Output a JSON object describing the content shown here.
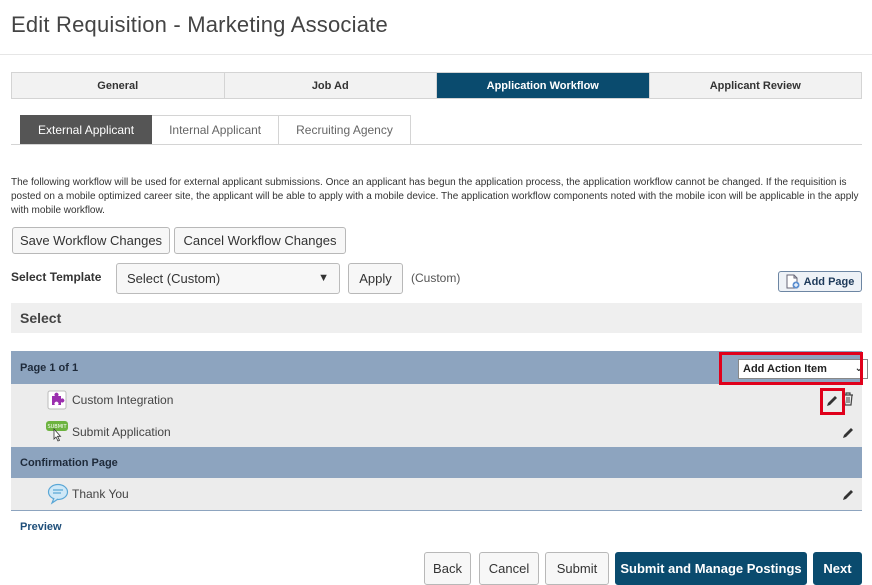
{
  "page": {
    "title": "Edit Requisition - Marketing Associate"
  },
  "main_tabs": [
    {
      "label": "General",
      "active": false
    },
    {
      "label": "Job Ad",
      "active": false
    },
    {
      "label": "Application Workflow",
      "active": true
    },
    {
      "label": "Applicant Review",
      "active": false
    }
  ],
  "sub_tabs": [
    {
      "label": "External Applicant",
      "active": true
    },
    {
      "label": "Internal Applicant",
      "active": false
    },
    {
      "label": "Recruiting Agency",
      "active": false
    }
  ],
  "description": "The following workflow will be used for external applicant submissions. Once an applicant has begun the application process, the application workflow cannot be changed. If the requisition is posted on a mobile optimized career site, the applicant will be able to apply with a mobile device. The application workflow components noted with the mobile icon will be applicable in the apply with mobile workflow.",
  "workflow_buttons": {
    "save": "Save Workflow Changes",
    "cancel": "Cancel Workflow Changes"
  },
  "template": {
    "label": "Select Template",
    "selected": "Select (Custom)",
    "apply": "Apply",
    "note": "(Custom)",
    "add_page": "Add Page"
  },
  "select_header": "Select",
  "workflow": {
    "page_header": "Page 1 of 1",
    "action_select": "Add Action Item",
    "items": [
      {
        "label": "Custom Integration",
        "icon": "puzzle-icon"
      },
      {
        "label": "Submit Application",
        "icon": "submit-icon"
      }
    ],
    "confirmation_header": "Confirmation Page",
    "confirmation_items": [
      {
        "label": "Thank You",
        "icon": "speech-bubble-icon"
      }
    ]
  },
  "preview_link": "Preview",
  "footer_buttons": {
    "back": "Back",
    "cancel": "Cancel",
    "submit": "Submit",
    "submit_manage": "Submit and Manage Postings",
    "next": "Next"
  },
  "colors": {
    "primary": "#0a4b6e",
    "section_header": "#8da4bf",
    "highlight": "#e0001b",
    "puzzle": "#9b2fae",
    "submit_icon": "#6cb33f"
  }
}
